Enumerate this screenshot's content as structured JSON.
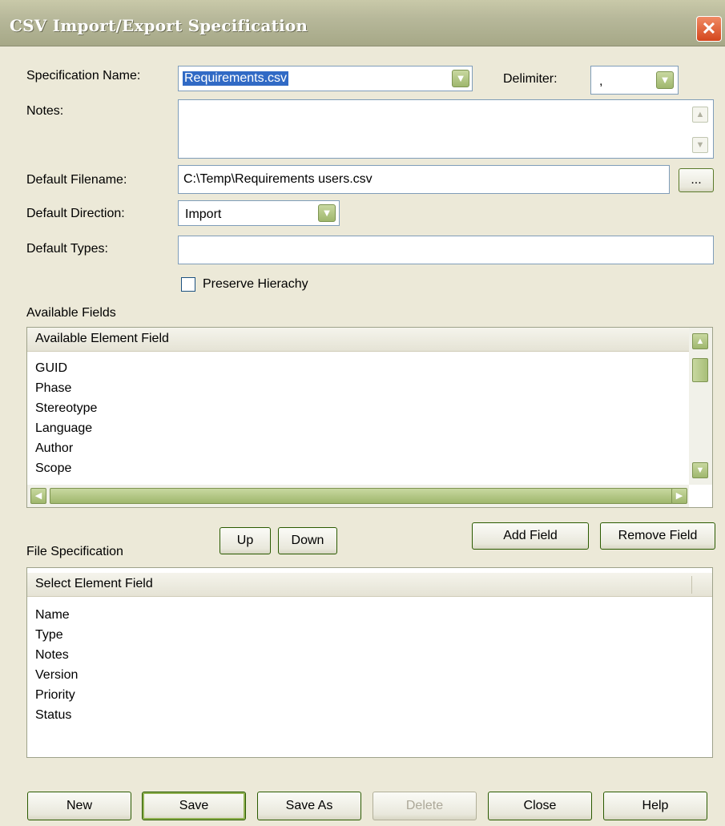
{
  "window": {
    "title": "CSV Import/Export Specification",
    "close_glyph": "✕"
  },
  "form": {
    "spec_name_label": "Specification Name:",
    "spec_name_value": "Requirements.csv",
    "delimiter_label": "Delimiter:",
    "delimiter_value": ",",
    "notes_label": "Notes:",
    "notes_value": "",
    "filename_label": "Default Filename:",
    "filename_value": "C:\\Temp\\Requirements users.csv",
    "browse_label": "...",
    "direction_label": "Default Direction:",
    "direction_value": "Import",
    "types_label": "Default Types:",
    "types_value": "",
    "preserve_label": "Preserve Hierachy",
    "preserve_checked": false
  },
  "available": {
    "section_label": "Available Fields",
    "column_header": "Available Element Field",
    "items": [
      "GUID",
      "Phase",
      "Stereotype",
      "Language",
      "Author",
      "Scope"
    ]
  },
  "controls": {
    "up_label": "Up",
    "down_label": "Down",
    "add_field_label": "Add Field",
    "remove_field_label": "Remove Field"
  },
  "file_spec": {
    "section_label": "File Specification",
    "column_header": "Select Element Field",
    "items": [
      "Name",
      "Type",
      "Notes",
      "Version",
      "Priority",
      "Status"
    ]
  },
  "buttons": {
    "new": "New",
    "save": "Save",
    "save_as": "Save As",
    "delete": "Delete",
    "close": "Close",
    "help": "Help"
  },
  "icons": {
    "dropdown": "chevron-down-icon",
    "scroll_up": "arrow-up-icon",
    "scroll_down": "arrow-down-icon",
    "scroll_left": "arrow-left-icon",
    "scroll_right": "arrow-right-icon"
  },
  "colors": {
    "dialog_bg": "#ece9d8",
    "title_bar": "#b7b89a",
    "close_button": "#d4471d",
    "accent_green": "#9fb76d",
    "field_border": "#7f9db9"
  }
}
